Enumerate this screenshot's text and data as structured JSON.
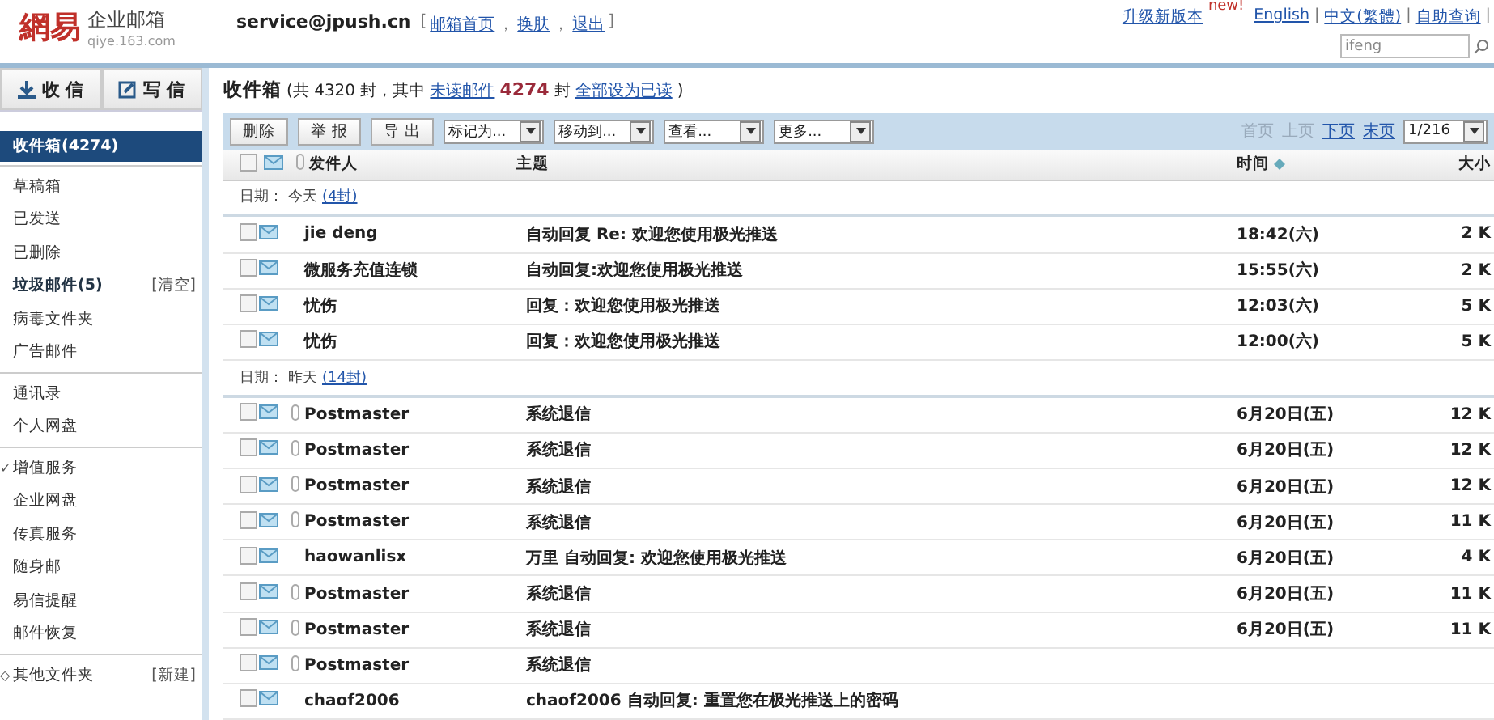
{
  "header": {
    "logo_mark": "網易",
    "logo_title": "企业邮箱",
    "logo_url": "qiye.163.com",
    "account": "service@jpush.cn",
    "account_links": [
      {
        "kind": "text",
        "text": "["
      },
      {
        "kind": "link",
        "text": "邮箱首页"
      },
      {
        "kind": "text",
        "text": "，"
      },
      {
        "kind": "link",
        "text": "换肤"
      },
      {
        "kind": "text",
        "text": "，"
      },
      {
        "kind": "link",
        "text": "退出"
      },
      {
        "kind": "text",
        "text": "]"
      }
    ],
    "upgrade": "升级新版本",
    "upgrade_badge": "new!",
    "top_links": [
      {
        "kind": "link",
        "text": "English"
      },
      {
        "kind": "text",
        "text": "|"
      },
      {
        "kind": "link",
        "text": "中文(繁體)"
      },
      {
        "kind": "text",
        "text": "|"
      },
      {
        "kind": "link",
        "text": "自助查询"
      },
      {
        "kind": "text",
        "text": "|"
      }
    ],
    "search": {
      "value": "ifeng"
    }
  },
  "sidebar": {
    "actions": [
      "收 信",
      "写 信"
    ],
    "groups": [
      {
        "items": [
          {
            "label": "收件箱(4274)",
            "selected": true,
            "bold": true
          }
        ]
      },
      {
        "items": [
          {
            "label": "草稿箱",
            "selected": false,
            "bold": false
          },
          {
            "label": "已发送",
            "selected": false,
            "bold": false
          },
          {
            "label": "已删除",
            "selected": false,
            "bold": false
          },
          {
            "label": "垃圾邮件(5)",
            "selected": false,
            "bold": true,
            "action": "[清空]"
          },
          {
            "label": "病毒文件夹",
            "selected": false,
            "bold": false
          },
          {
            "label": "广告邮件",
            "selected": false,
            "bold": false
          }
        ]
      },
      {
        "items": [
          {
            "label": "通讯录",
            "selected": false,
            "bold": false
          },
          {
            "label": "个人网盘",
            "selected": false,
            "bold": false
          }
        ]
      },
      {
        "items": [
          {
            "label": "增值服务",
            "selected": false,
            "bold": false,
            "marker": "✓"
          },
          {
            "label": "企业网盘",
            "selected": false,
            "bold": false
          },
          {
            "label": "传真服务",
            "selected": false,
            "bold": false
          },
          {
            "label": "随身邮",
            "selected": false,
            "bold": false
          },
          {
            "label": "易信提醒",
            "selected": false,
            "bold": false
          },
          {
            "label": "邮件恢复",
            "selected": false,
            "bold": false
          }
        ]
      },
      {
        "items": [
          {
            "label": "其他文件夹",
            "selected": false,
            "bold": false,
            "marker": "◇",
            "action": "[新建]"
          }
        ]
      }
    ]
  },
  "folder": {
    "title": "收件箱",
    "summary_pre": "(共 4320 封，其中",
    "unread_link": "未读邮件",
    "unread_count": "4274",
    "unread_unit": "封",
    "mark_all_link": "全部设为已读",
    "summary_post": ")"
  },
  "toolbar": {
    "buttons": [
      "删除",
      "举 报",
      "导 出"
    ],
    "selects": [
      "标记为...",
      "移动到...",
      "查看...",
      "更多..."
    ],
    "pager": [
      {
        "label": "首页",
        "disabled": true
      },
      {
        "label": "上页",
        "disabled": true
      },
      {
        "label": "下页",
        "disabled": false
      },
      {
        "label": "末页",
        "disabled": false
      }
    ],
    "page": "1/216"
  },
  "table": {
    "select_all_checked": false,
    "columns": [
      "发件人",
      "主题",
      "时间",
      "大小"
    ],
    "groups": [
      {
        "label": "日期：",
        "day": "今天",
        "count": "(4封)",
        "rows": [
          {
            "sender": "jie deng",
            "subject": "自动回复 Re: 欢迎您使用极光推送",
            "time": "18:42(六)",
            "size": "2 K",
            "attachment": false,
            "checked": false
          },
          {
            "sender": "微服务充值连锁",
            "subject": "自动回复:欢迎您使用极光推送",
            "time": "15:55(六)",
            "size": "2 K",
            "attachment": false,
            "checked": false
          },
          {
            "sender": "忧伤",
            "subject": "回复：欢迎您使用极光推送",
            "time": "12:03(六)",
            "size": "5 K",
            "attachment": false,
            "checked": false
          },
          {
            "sender": "忧伤",
            "subject": "回复：欢迎您使用极光推送",
            "time": "12:00(六)",
            "size": "5 K",
            "attachment": false,
            "checked": false
          }
        ]
      },
      {
        "label": "日期：",
        "day": "昨天",
        "count": "(14封)",
        "rows": [
          {
            "sender": "Postmaster",
            "subject": "系统退信",
            "time": "6月20日(五)",
            "size": "12 K",
            "attachment": true,
            "checked": false
          },
          {
            "sender": "Postmaster",
            "subject": "系统退信",
            "time": "6月20日(五)",
            "size": "12 K",
            "attachment": true,
            "checked": false
          },
          {
            "sender": "Postmaster",
            "subject": "系统退信",
            "time": "6月20日(五)",
            "size": "12 K",
            "attachment": true,
            "checked": false
          },
          {
            "sender": "Postmaster",
            "subject": "系统退信",
            "time": "6月20日(五)",
            "size": "11 K",
            "attachment": true,
            "checked": false
          },
          {
            "sender": "haowanlisx",
            "subject": "万里 自动回复: 欢迎您使用极光推送",
            "time": "6月20日(五)",
            "size": "4 K",
            "attachment": false,
            "checked": false
          },
          {
            "sender": "Postmaster",
            "subject": "系统退信",
            "time": "6月20日(五)",
            "size": "11 K",
            "attachment": true,
            "checked": false
          },
          {
            "sender": "Postmaster",
            "subject": "系统退信",
            "time": "6月20日(五)",
            "size": "11 K",
            "attachment": true,
            "checked": false
          },
          {
            "sender": "Postmaster",
            "subject": "系统退信",
            "attachment": true,
            "checked": false
          },
          {
            "sender": "chaof2006",
            "subject": "chaof2006 自动回复: 重置您在极光推送上的密码",
            "attachment": false,
            "checked": false
          }
        ]
      }
    ]
  }
}
